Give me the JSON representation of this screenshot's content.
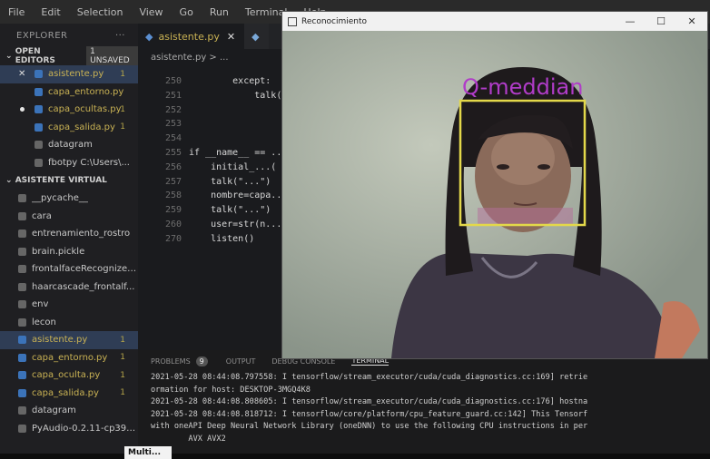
{
  "menubar": [
    "File",
    "Edit",
    "Selection",
    "View",
    "Go",
    "Run",
    "Terminal",
    "Help"
  ],
  "sidebar": {
    "title": "EXPLORER",
    "more": "···",
    "open_editors": {
      "label": "OPEN EDITORS",
      "badge": "1 UNSAVED"
    },
    "open_files": [
      {
        "name": "asistente.py",
        "status": "1",
        "color": "#c9b254",
        "selected": true,
        "marker": "x"
      },
      {
        "name": "capa_entorno.py",
        "status": "",
        "color": "#c9b254"
      },
      {
        "name": "capa_ocultas.py",
        "status": "1",
        "color": "#c9b254",
        "marker": "dot"
      },
      {
        "name": "capa_salida.py",
        "status": "1",
        "color": "#c9b254"
      },
      {
        "name": "datagram",
        "status": "",
        "color": "#c8c8c8"
      },
      {
        "name": "fbotpy  C:\\Users\\...",
        "status": "",
        "color": "#c8c8c8"
      }
    ],
    "project": {
      "label": "ASISTENTE VIRTUAL"
    },
    "project_items": [
      {
        "name": "__pycache__",
        "color": "#c8c8c8"
      },
      {
        "name": "cara",
        "color": "#c8c8c8"
      },
      {
        "name": "entrenamiento_rostro",
        "color": "#c8c8c8"
      },
      {
        "name": "brain.pickle",
        "color": "#c8c8c8"
      },
      {
        "name": "frontalfaceRecognizer...",
        "color": "#c8c8c8"
      },
      {
        "name": "haarcascade_frontalf...",
        "color": "#c8c8c8"
      },
      {
        "name": "env",
        "color": "#c8c8c8"
      },
      {
        "name": "lecon",
        "color": "#c8c8c8"
      },
      {
        "name": "asistente.py",
        "status": "1",
        "color": "#c9b254",
        "selected": true
      },
      {
        "name": "capa_entorno.py",
        "status": "1",
        "color": "#c9b254"
      },
      {
        "name": "capa_oculta.py",
        "status": "1",
        "color": "#c9b254"
      },
      {
        "name": "capa_salida.py",
        "status": "1",
        "color": "#c9b254"
      },
      {
        "name": "datagram",
        "color": "#c8c8c8"
      },
      {
        "name": "PyAudio-0.2.11-cp39-...",
        "color": "#c8c8c8"
      }
    ]
  },
  "editor": {
    "tabs": [
      {
        "label": "asistente.py",
        "close": "✕"
      },
      {
        "label": "",
        "close": ""
      }
    ],
    "breadcrumb": "asistente.py > ...",
    "lines": [
      {
        "num": "250",
        "code": "        except:"
      },
      {
        "num": "251",
        "code": "            talk(\""
      },
      {
        "num": "252",
        "code": ""
      },
      {
        "num": "253",
        "code": ""
      },
      {
        "num": "254",
        "code": ""
      },
      {
        "num": "255",
        "code": "if __name__ == ..."
      },
      {
        "num": "256",
        "code": "    initial_...("
      },
      {
        "num": "257",
        "code": "    talk(\"...\")"
      },
      {
        "num": "258",
        "code": "    nombre=capa..."
      },
      {
        "num": "259",
        "code": "    talk(\"...\")"
      },
      {
        "num": "260",
        "code": "    user=str(n..."
      },
      {
        "num": "270",
        "code": "    listen()"
      }
    ]
  },
  "panel": {
    "tabs": [
      "PROBLEMS",
      "9",
      "OUTPUT",
      "DEBUG CONSOLE",
      "TERMINAL"
    ],
    "terminal": [
      "2021-05-28 08:44:08.797558: I tensorflow/stream_executor/cuda/cuda_diagnostics.cc:169] retrie",
      "ormation for host: DESKTOP-3MGQ4K8",
      "2021-05-28 08:44:08.808605: I tensorflow/stream_executor/cuda/cuda_diagnostics.cc:176] hostna",
      "2021-05-28 08:44:08.818712: I tensorflow/core/platform/cpu_feature_guard.cc:142] This Tensorf",
      "with oneAPI Deep Neural Network Library (oneDNN) to use the following CPU instructions in per",
      "        AVX AVX2"
    ]
  },
  "window": {
    "title": "Reconocimiento",
    "controls": [
      "—",
      "☐",
      "✕"
    ],
    "detection_label": "Q-meddian",
    "detection_label_color": "#b03cc8",
    "box_color": "#e3d84a"
  },
  "taskbar": {
    "label": "Multi..."
  },
  "colors": {
    "accent": "#c9b254",
    "selection": "#2f3d55"
  }
}
